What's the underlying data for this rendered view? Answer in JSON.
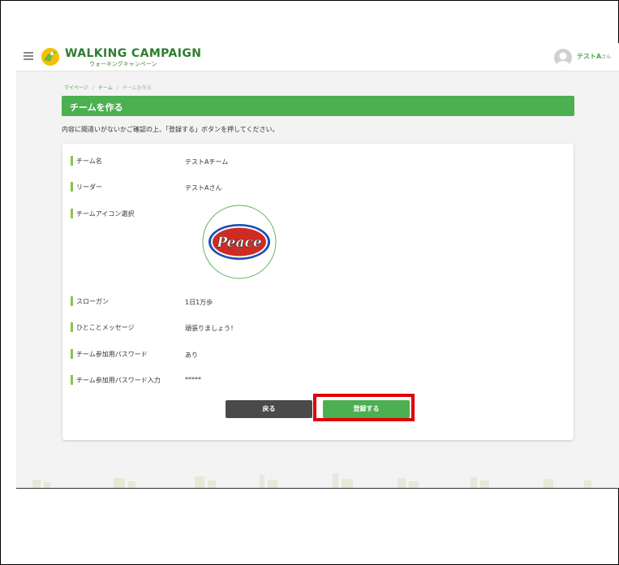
{
  "header": {
    "brand_title": "WALKING CAMPAIGN",
    "brand_subtitle": "ウォーキングキャンペーン",
    "user_name": "テストA",
    "user_honorific": "さん"
  },
  "breadcrumb": {
    "items": [
      "マイページ",
      "チーム",
      "チームを作る"
    ],
    "separator": "/"
  },
  "page": {
    "title": "チームを作る",
    "instruction": "内容に間違いがないかご確認の上、「登録する」ボタンを押してください。"
  },
  "form": {
    "rows": [
      {
        "label": "チーム名",
        "value": "テストAチーム"
      },
      {
        "label": "リーダー",
        "value": "テストAさん"
      },
      {
        "label": "チームアイコン選択",
        "value": ""
      },
      {
        "label": "スローガン",
        "value": "1日1万歩"
      },
      {
        "label": "ひとことメッセージ",
        "value": "頑張りましょう！"
      },
      {
        "label": "チーム参加用パスワード",
        "value": "あり"
      },
      {
        "label": "チーム参加用パスワード入力",
        "value": "*****"
      }
    ],
    "team_icon_text": "Peace"
  },
  "buttons": {
    "back": "戻る",
    "register": "登録する"
  },
  "colors": {
    "accent_green": "#4caf50",
    "label_bar": "#8bc34a",
    "highlight": "#e00000",
    "back_button": "#4a4a4a"
  }
}
